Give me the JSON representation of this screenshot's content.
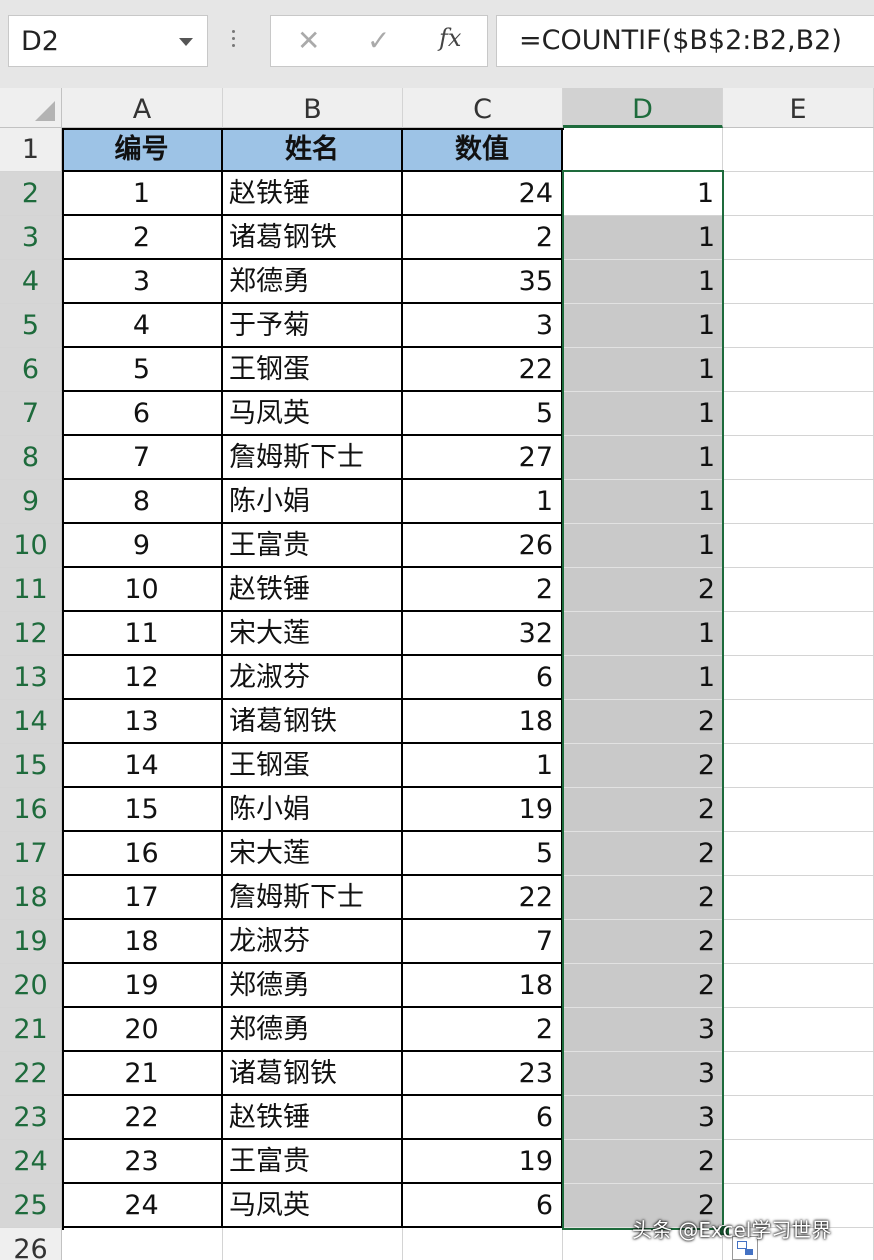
{
  "formula_bar": {
    "name_box": "D2",
    "cancel_icon": "✕",
    "enter_icon": "✓",
    "fx_label": "fx",
    "formula": "=COUNTIF($B$2:B2,B2)"
  },
  "sheet": {
    "columns": [
      "A",
      "B",
      "C",
      "D",
      "E"
    ],
    "selected_column": "D",
    "header_row": {
      "A": "编号",
      "B": "姓名",
      "C": "数值",
      "D": ""
    },
    "rows": [
      {
        "n": "2",
        "a": "1",
        "b": "赵铁锤",
        "c": "24",
        "d": "1"
      },
      {
        "n": "3",
        "a": "2",
        "b": "诸葛钢铁",
        "c": "2",
        "d": "1"
      },
      {
        "n": "4",
        "a": "3",
        "b": "郑德勇",
        "c": "35",
        "d": "1"
      },
      {
        "n": "5",
        "a": "4",
        "b": "于予菊",
        "c": "3",
        "d": "1"
      },
      {
        "n": "6",
        "a": "5",
        "b": "王钢蛋",
        "c": "22",
        "d": "1"
      },
      {
        "n": "7",
        "a": "6",
        "b": "马凤英",
        "c": "5",
        "d": "1"
      },
      {
        "n": "8",
        "a": "7",
        "b": "詹姆斯下士",
        "c": "27",
        "d": "1"
      },
      {
        "n": "9",
        "a": "8",
        "b": "陈小娟",
        "c": "1",
        "d": "1"
      },
      {
        "n": "10",
        "a": "9",
        "b": "王富贵",
        "c": "26",
        "d": "1"
      },
      {
        "n": "11",
        "a": "10",
        "b": "赵铁锤",
        "c": "2",
        "d": "2"
      },
      {
        "n": "12",
        "a": "11",
        "b": "宋大莲",
        "c": "32",
        "d": "1"
      },
      {
        "n": "13",
        "a": "12",
        "b": "龙淑芬",
        "c": "6",
        "d": "1"
      },
      {
        "n": "14",
        "a": "13",
        "b": "诸葛钢铁",
        "c": "18",
        "d": "2"
      },
      {
        "n": "15",
        "a": "14",
        "b": "王钢蛋",
        "c": "1",
        "d": "2"
      },
      {
        "n": "16",
        "a": "15",
        "b": "陈小娟",
        "c": "19",
        "d": "2"
      },
      {
        "n": "17",
        "a": "16",
        "b": "宋大莲",
        "c": "5",
        "d": "2"
      },
      {
        "n": "18",
        "a": "17",
        "b": "詹姆斯下士",
        "c": "22",
        "d": "2"
      },
      {
        "n": "19",
        "a": "18",
        "b": "龙淑芬",
        "c": "7",
        "d": "2"
      },
      {
        "n": "20",
        "a": "19",
        "b": "郑德勇",
        "c": "18",
        "d": "2"
      },
      {
        "n": "21",
        "a": "20",
        "b": "郑德勇",
        "c": "2",
        "d": "3"
      },
      {
        "n": "22",
        "a": "21",
        "b": "诸葛钢铁",
        "c": "23",
        "d": "3"
      },
      {
        "n": "23",
        "a": "22",
        "b": "赵铁锤",
        "c": "6",
        "d": "3"
      },
      {
        "n": "24",
        "a": "23",
        "b": "王富贵",
        "c": "19",
        "d": "2"
      },
      {
        "n": "25",
        "a": "24",
        "b": "马凤英",
        "c": "6",
        "d": "2"
      }
    ],
    "extra_rows": [
      "26"
    ]
  },
  "watermark": "头条 @Excel学习世界",
  "colors": {
    "header_fill": "#9dc3e6",
    "selection_border": "#1e6b3c",
    "selection_fill": "#c9c9c9"
  }
}
